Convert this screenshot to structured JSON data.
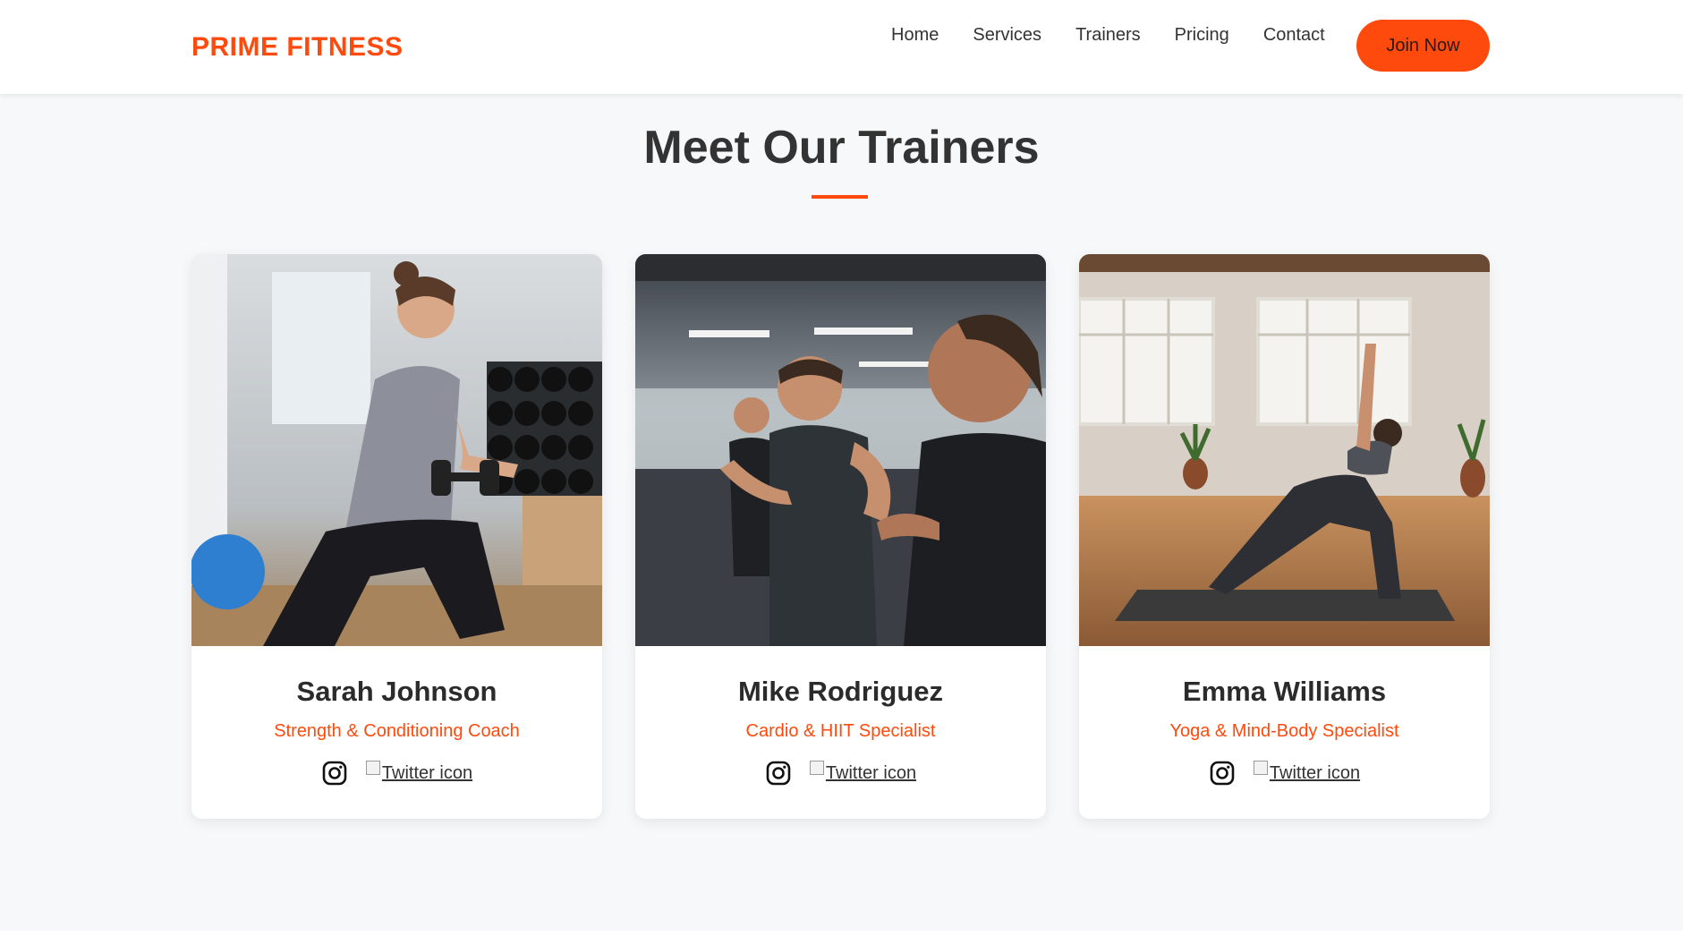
{
  "brand": {
    "logo_text": "PRIME FITNESS",
    "accent_color": "#ff4a0d"
  },
  "nav": {
    "items": [
      {
        "label": "Home"
      },
      {
        "label": "Services"
      },
      {
        "label": "Trainers"
      },
      {
        "label": "Pricing"
      },
      {
        "label": "Contact"
      }
    ],
    "cta_label": "Join Now"
  },
  "section": {
    "title": "Meet Our Trainers"
  },
  "trainers": [
    {
      "name": "Sarah Johnson",
      "role": "Strength & Conditioning Coach",
      "instagram_icon": "instagram-icon",
      "twitter_alt": "Twitter icon"
    },
    {
      "name": "Mike Rodriguez",
      "role": "Cardio & HIIT Specialist",
      "instagram_icon": "instagram-icon",
      "twitter_alt": "Twitter icon"
    },
    {
      "name": "Emma Williams",
      "role": "Yoga & Mind-Body Specialist",
      "instagram_icon": "instagram-icon",
      "twitter_alt": "Twitter icon"
    }
  ]
}
